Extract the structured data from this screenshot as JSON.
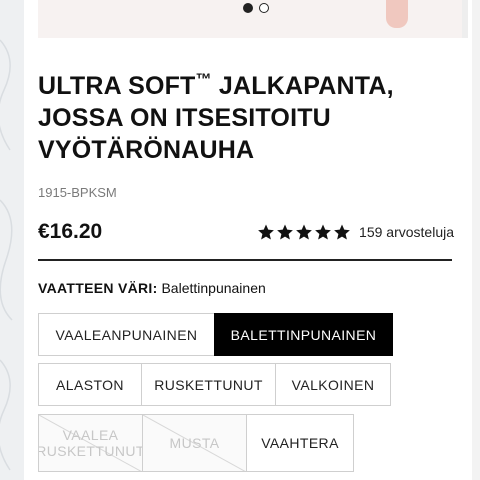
{
  "carousel": {
    "slide_count": 2,
    "active_index": 0
  },
  "product": {
    "title_part1": "ULTRA SOFT",
    "title_tm": "™",
    "title_part2": " JALKAPANTA, JOSSA ON ITSESITOITU VYÖTÄRÖNAUHA",
    "sku": "1915-BPKSM",
    "price": "€16.20"
  },
  "reviews": {
    "rating": 5,
    "max_rating": 5,
    "text": "159 arvosteluja"
  },
  "color": {
    "label": "VAATTEEN VÄRI:",
    "selected_value": "Balettinpunainen",
    "options": [
      {
        "label": "VAALEANPUNAINEN",
        "state": "available"
      },
      {
        "label": "BALETTINPUNAINEN",
        "state": "selected"
      },
      {
        "label": "ALASTON",
        "state": "available"
      },
      {
        "label": "RUSKETTUNUT",
        "state": "available"
      },
      {
        "label": "VALKOINEN",
        "state": "available"
      },
      {
        "label": "VAALEA RUSKETTUNUT",
        "state": "unavailable"
      },
      {
        "label": "MUSTA",
        "state": "unavailable"
      },
      {
        "label": "VAAHTERA",
        "state": "available"
      }
    ]
  },
  "colors": {
    "selected_bg": "#000000",
    "text": "#111111",
    "muted": "#7a7a7a",
    "border": "#cfcfcf"
  }
}
